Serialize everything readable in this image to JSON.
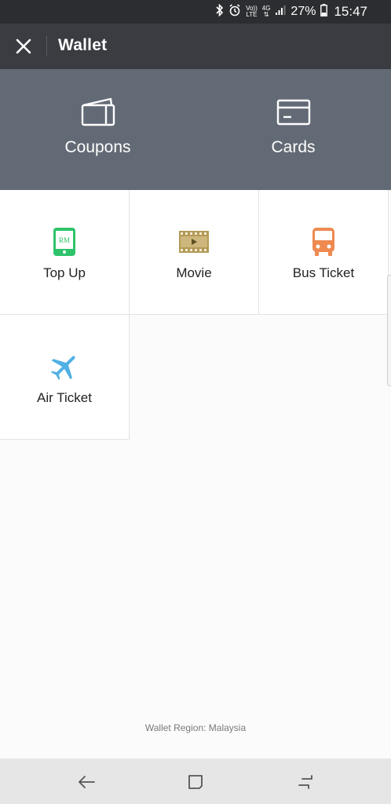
{
  "status_bar": {
    "volte_label": "Vo))",
    "lte_label": "LTE",
    "network_label": "4G",
    "battery": "27%",
    "time": "15:47"
  },
  "app_bar": {
    "title": "Wallet"
  },
  "hero": {
    "coupons_label": "Coupons",
    "cards_label": "Cards"
  },
  "services": [
    {
      "label": "Top Up",
      "icon": "topup-phone-icon",
      "color": "#2ec36a",
      "icon_text": "RM"
    },
    {
      "label": "Movie",
      "icon": "film-strip-icon",
      "color": "#b39a55"
    },
    {
      "label": "Bus Ticket",
      "icon": "bus-icon",
      "color": "#ee8a50"
    },
    {
      "label": "Air Ticket",
      "icon": "airplane-icon",
      "color": "#4fb0e4"
    }
  ],
  "footer": {
    "region_text": "Wallet Region: Malaysia"
  },
  "colors": {
    "status_bar_bg": "#2c2d30",
    "app_bar_bg": "#3a3c42",
    "hero_bg": "#626a75",
    "page_bg": "#fbfbfb",
    "nav_bar_bg": "#e6e6e6"
  }
}
